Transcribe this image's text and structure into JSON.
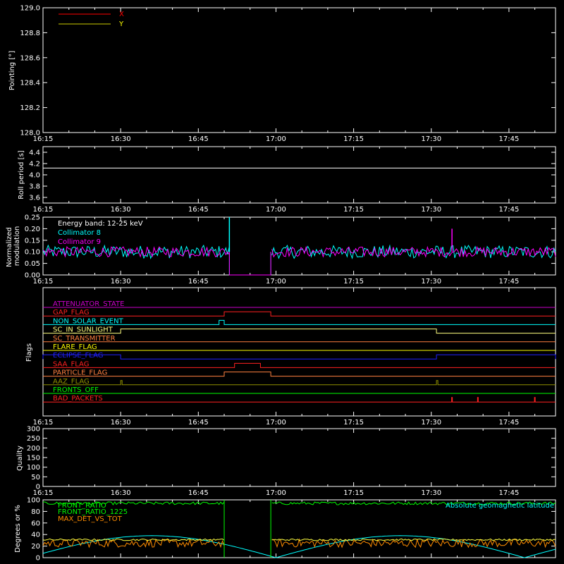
{
  "time_ticks": [
    "16:15",
    "16:30",
    "16:45",
    "17:00",
    "17:15",
    "17:30",
    "17:45"
  ],
  "chart_data": [
    {
      "type": "line",
      "ylabel": "Pointing [°]",
      "ylim": [
        128.0,
        129.0
      ],
      "ytick_labels": [
        "128.0",
        "128.2",
        "128.4",
        "128.6",
        "128.8",
        "129.0"
      ],
      "legend": [
        {
          "name": "X",
          "color": "#ff0000"
        },
        {
          "name": "Y",
          "color": "#ffff00"
        }
      ],
      "series": []
    },
    {
      "type": "line",
      "ylabel": "Roll period [s]",
      "ylim": [
        3.5,
        4.5
      ],
      "ytick_labels": [
        "3.6",
        "3.8",
        "4.0",
        "4.2",
        "4.4"
      ],
      "series": [
        {
          "color": "#ffffff",
          "x": [
            "16:15",
            "17:54"
          ],
          "values": [
            4.12,
            4.12
          ]
        }
      ]
    },
    {
      "type": "line",
      "ylabel": "Normalized modulation",
      "ylim": [
        0.0,
        0.25
      ],
      "ytick_labels": [
        "0.00",
        "0.05",
        "0.10",
        "0.15",
        "0.20",
        "0.25"
      ],
      "annotation": "Energy band: 12-25 keV",
      "legend": [
        {
          "name": "Collimator 8",
          "color": "#00ffff"
        },
        {
          "name": "Collimator 9",
          "color": "#ff00ff"
        }
      ],
      "series": [
        {
          "name": "Collimator 8",
          "color": "#00ffff",
          "baseline": 0.1,
          "spread": 0.028,
          "gap": [
            "16:51",
            "16:59"
          ],
          "peak": {
            "x": "16:51",
            "value": 0.25
          }
        },
        {
          "name": "Collimator 9",
          "color": "#ff00ff",
          "baseline": 0.1,
          "spread": 0.022,
          "gap": [
            "16:51",
            "16:59"
          ],
          "peak": {
            "x": "17:34",
            "value": 0.2
          }
        }
      ]
    },
    {
      "type": "line",
      "ylabel": "Flags",
      "flags": [
        {
          "name": "ATTENUATOR_STATE",
          "color": "#cc00cc",
          "on": []
        },
        {
          "name": "GAP_FLAG",
          "color": "#ff2020",
          "on": [
            [
              "16:50",
              "16:59"
            ]
          ]
        },
        {
          "name": "NON_SOLAR_EVENT",
          "color": "#00ffff",
          "on": [
            [
              "16:49",
              "16:50"
            ]
          ]
        },
        {
          "name": "SC_IN_SUNLIGHT",
          "color": "#ffff80",
          "on": [
            [
              "16:30",
              "17:31"
            ]
          ]
        },
        {
          "name": "SC_TRANSMITTER",
          "color": "#ff8040",
          "on": []
        },
        {
          "name": "FLARE_FLAG",
          "color": "#ffff00",
          "on": []
        },
        {
          "name": "ECLIPSE_FLAG",
          "color": "#2020ff",
          "on": [
            [
              "16:15",
              "16:30"
            ],
            [
              "17:31",
              "17:54"
            ]
          ]
        },
        {
          "name": "SAA_FLAG",
          "color": "#ff2020",
          "on": [
            [
              "16:52",
              "16:57"
            ]
          ]
        },
        {
          "name": "PARTICLE_FLAG",
          "color": "#ff8040",
          "on": [
            [
              "16:50",
              "16:59"
            ]
          ]
        },
        {
          "name": "AAZ_FLAG",
          "color": "#909000",
          "on": [
            [
              "16:30",
              "16:30"
            ],
            [
              "17:31",
              "17:31"
            ]
          ]
        },
        {
          "name": "FRONTS_OFF",
          "color": "#00ff00",
          "on": []
        },
        {
          "name": "BAD_PACKETS",
          "color": "#ff2020",
          "on": [
            [
              "17:34",
              "17:34"
            ],
            [
              "17:39",
              "17:39"
            ],
            [
              "17:50",
              "17:50"
            ]
          ]
        }
      ]
    },
    {
      "type": "line",
      "ylabel": "Quality",
      "ylim": [
        0,
        300
      ],
      "ytick_labels": [
        "0",
        "50",
        "100",
        "150",
        "200",
        "250",
        "300"
      ],
      "series": []
    },
    {
      "type": "line",
      "ylabel": "Degrees or %",
      "ylim": [
        0,
        100
      ],
      "ytick_labels": [
        "0",
        "20",
        "40",
        "60",
        "80",
        "100"
      ],
      "legend": [
        {
          "name": "FRONT_RATIO",
          "color": "#00ff00"
        },
        {
          "name": "FRONT_RATIO_1225",
          "color": "#00ff00"
        },
        {
          "name": "MAX_DET_VS_TOT",
          "color": "#ff8c00"
        }
      ],
      "legend_right": {
        "name": "Absolute geomagnetic latitude",
        "color": "#00ffff"
      },
      "series": [
        {
          "name": "FRONT_RATIO",
          "color": "#00ff00",
          "baseline": 94,
          "spread": 2.5,
          "gap": [
            "16:50",
            "16:59"
          ]
        },
        {
          "name": "MAX_DET_VS_TOT",
          "color": "#ff8c00",
          "baseline": 25,
          "spread": 7,
          "gap": [
            "16:50",
            "16:59"
          ]
        },
        {
          "name": "FRONT_RATIO_1225",
          "color": "#ffff40",
          "baseline": 31,
          "spread": 1.5,
          "gap": [
            "16:50",
            "16:59"
          ]
        },
        {
          "name": "Absolute geomagnetic latitude",
          "color": "#00ffff",
          "min": 0,
          "max": 38
        }
      ]
    }
  ]
}
